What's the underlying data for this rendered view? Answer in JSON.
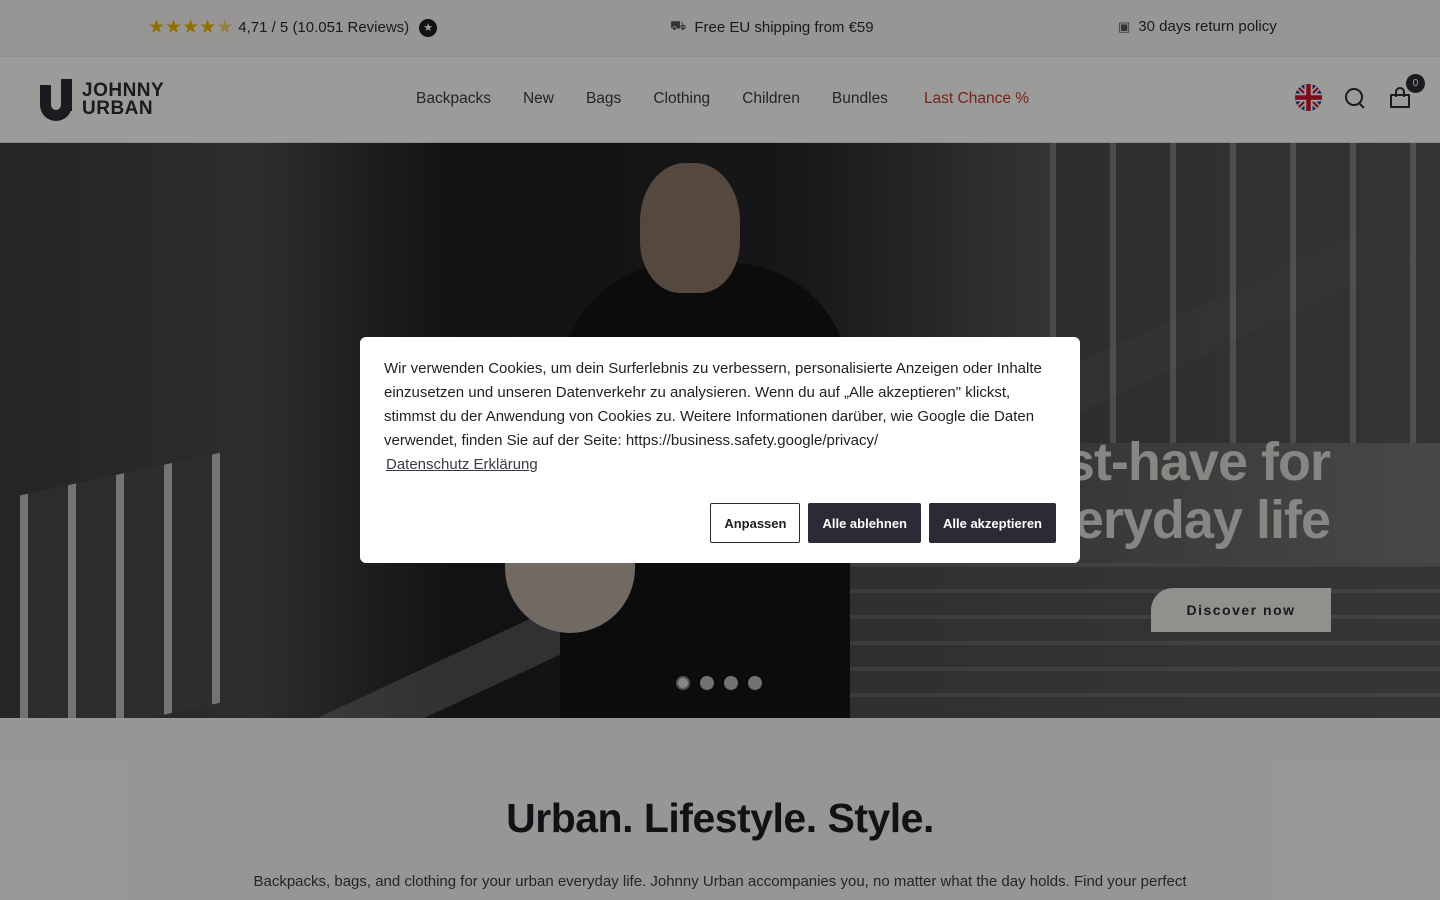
{
  "topbar": {
    "rating_text": "4,71 / 5 (10.051 Reviews)",
    "shipping_text": "Free EU shipping from €59",
    "return_text": "30 days return policy"
  },
  "brand": {
    "line1": "JOHNNY",
    "line2": "URBAN"
  },
  "nav": {
    "items": [
      "Backpacks",
      "New",
      "Bags",
      "Clothing",
      "Children",
      "Bundles"
    ],
    "sale": "Last Chance %"
  },
  "cart": {
    "count": "0"
  },
  "hero": {
    "headline_line1": "st-have for",
    "headline_line2": "eryday life",
    "cta": "Discover now"
  },
  "intro": {
    "title": "Urban. Lifestyle. Style.",
    "text": "Backpacks, bags, and clothing for your urban everyday life. Johnny Urban accompanies you, no matter what the day holds. Find your perfect"
  },
  "cookie": {
    "text": "Wir verwenden Cookies, um dein Surferlebnis zu verbessern, personalisierte Anzeigen oder Inhalte einzusetzen und unseren Datenverkehr zu analysieren. Wenn du auf „Alle akzeptieren\" klickst, stimmst du der Anwendung von Cookies zu. Weitere Informationen darüber, wie Google die Daten verwendet, finden Sie auf der Seite: https://business.safety.google/privacy/",
    "privacy_link": "Datenschutz Erklärung",
    "customize": "Anpassen",
    "reject_all": "Alle ablehnen",
    "accept_all": "Alle akzeptieren"
  },
  "colors": {
    "sale": "#c0392b",
    "dark_button": "#2b2b38",
    "star": "#e9b400"
  }
}
